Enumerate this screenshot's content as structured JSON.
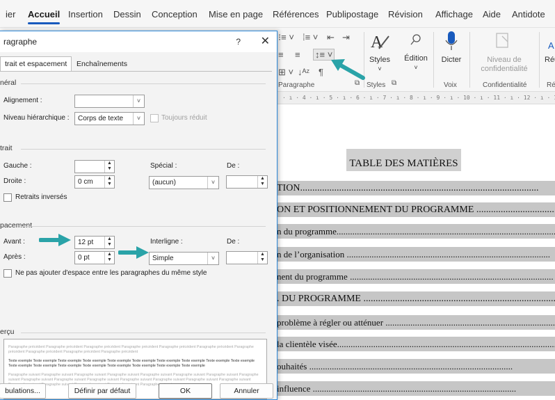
{
  "ribbon": {
    "tabs": [
      "ier",
      "Accueil",
      "Insertion",
      "Dessin",
      "Conception",
      "Mise en page",
      "Références",
      "Publipostage",
      "Révision",
      "Affichage",
      "Aide",
      "Antidote"
    ],
    "active_tab": "Accueil",
    "styles_label": "Styles",
    "edition_label": "Édition",
    "dicter_label": "Dicter",
    "niveau_label": "Niveau de confidentialité",
    "reu_label": "Réu",
    "group_paragraphe": "Paragraphe",
    "group_styles": "Styles",
    "group_voix": "Voix",
    "group_confidentialite": "Confidentialité",
    "group_re": "Ré",
    "ruler": "· ı · 4 · ı · 5 · ı · 6 · ı · 7 · ı · 8 · ı · 9 · ı · 10 · ı · 11 · ı · 12 · ı · 13 · ı · 14 ·"
  },
  "document": {
    "toc_title": "TABLE DES MATIÈRES",
    "toc_lines": [
      {
        "text": "TION",
        "caps": true
      },
      {
        "text": "ON ET POSITIONNEMENT DU PROGRAMME",
        "caps": true
      },
      {
        "text": "n du programme",
        "caps": false
      },
      {
        "text": "n de l’organisation",
        "caps": false
      },
      {
        "text": "nent du programme",
        "caps": false
      },
      {
        "text": ". DU PROGRAMME",
        "caps": true
      },
      {
        "text": "problème à régler ou atténuer",
        "caps": false
      },
      {
        "text": "la clientèle visée",
        "caps": false
      },
      {
        "text": "ouhaités",
        "caps": false
      },
      {
        "text": "influence",
        "caps": false
      }
    ]
  },
  "dialog": {
    "title": "ragraphe",
    "help": "?",
    "close": "✕",
    "tab_indent": "trait et espacement",
    "tab_flow": "Enchaînements",
    "section_general": "néral",
    "alignement_label": "Alignement :",
    "alignement_value": "",
    "niveau_label": "Niveau hiérarchique :",
    "niveau_value": "Corps de texte",
    "toujours_reduit": "Toujours réduit",
    "section_retrait": "trait",
    "gauche_label": "Gauche :",
    "gauche_value": "",
    "droite_label": "Droite :",
    "droite_value": "0 cm",
    "special_label": "Spécial :",
    "special_value": "(aucun)",
    "de_label": "De :",
    "de_value": "",
    "retraits_inverses": "Retraits inversés",
    "section_espacement": "pacement",
    "avant_label": "Avant :",
    "avant_value": "12 pt",
    "apres_label": "Après :",
    "apres_value": "0 pt",
    "interligne_label": "Interligne :",
    "interligne_value": "Simple",
    "de2_label": "De :",
    "de2_value": "",
    "ne_pas_ajouter": "Ne pas ajouter d'espace entre les paragraphes du même style",
    "section_apercu": "erçu",
    "preview_prev": "Paragraphe précédent Paragraphe précédent Paragraphe précédent Paragraphe précédent Paragraphe précédent Paragraphe précédent Paragraphe précédent Paragraphe précédent Paragraphe précédent Paragraphe précédent",
    "preview_sample": "Texte exemple Texte exemple Texte exemple Texte exemple Texte exemple Texte exemple Texte exemple Texte exemple Texte exemple Texte exemple Texte exemple Texte exemple Texte exemple Texte exemple Texte exemple Texte exemple Texte exemple Texte exemple",
    "preview_next": "Paragraphe suivant Paragraphe suivant Paragraphe suivant Paragraphe suivant Paragraphe suivant Paragraphe suivant Paragraphe suivant Paragraphe suivant Paragraphe suivant Paragraphe suivant Paragraphe suivant Paragraphe suivant Paragraphe suivant Paragraphe suivant Paragraphe suivant Paragraphe suivant Paragraphe suivant Paragraphe suivant Paragraphe suivant Paragraphe suivant",
    "btn_tabulations": "bulations...",
    "btn_defaut": "Définir par défaut",
    "btn_ok": "OK",
    "btn_annuler": "Annuler"
  },
  "colors": {
    "accent": "#185abd",
    "annotation_arrow": "#2aa3a8",
    "toc_highlight": "#c6c6c6",
    "dialog_border": "#2b88d8"
  }
}
